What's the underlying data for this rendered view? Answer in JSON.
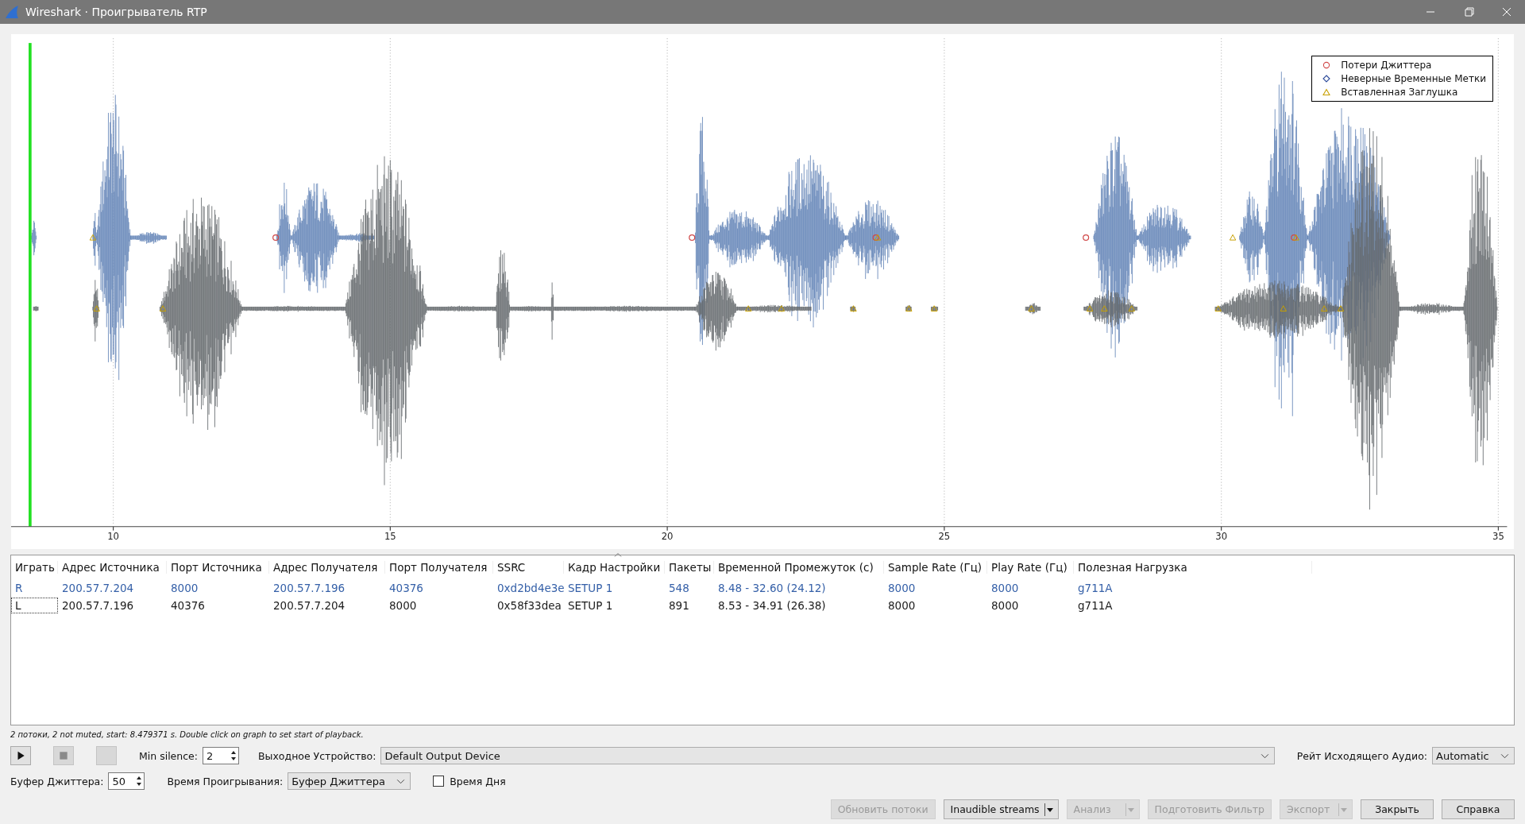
{
  "window": {
    "title": "Wireshark · Проигрыватель RTP"
  },
  "graph": {
    "x_ticks": [
      "10",
      "15",
      "20",
      "25",
      "30",
      "35"
    ],
    "legend": [
      {
        "label": "Потери Джиттера",
        "kind": "circle",
        "color": "#d04848"
      },
      {
        "label": "Неверные Временные Метки",
        "kind": "diamond",
        "color": "#2c4a9a"
      },
      {
        "label": "Вставленная Заглушка",
        "kind": "triangle",
        "color": "#c8a000"
      }
    ]
  },
  "streams_table": {
    "columns": [
      {
        "label": "Играть",
        "sorted": false
      },
      {
        "label": "Адрес Источника",
        "sorted": false
      },
      {
        "label": "Порт Источника",
        "sorted": false
      },
      {
        "label": "Адрес Получателя",
        "sorted": false
      },
      {
        "label": "Порт Получателя",
        "sorted": false
      },
      {
        "label": "SSRC",
        "sorted": false
      },
      {
        "label": "Кадр Настройки",
        "sorted": true
      },
      {
        "label": "Пакеты",
        "sorted": false
      },
      {
        "label": "Временной Промежуток (с)",
        "sorted": false
      },
      {
        "label": "Sample Rate (Гц)",
        "sorted": false
      },
      {
        "label": "Play Rate (Гц)",
        "sorted": false
      },
      {
        "label": "Полезная Нагрузка",
        "sorted": false
      }
    ],
    "rows": [
      {
        "color": "#3560a8",
        "focused": false,
        "cells": [
          "R",
          "200.57.7.204",
          "8000",
          "200.57.7.196",
          "40376",
          "0xd2bd4e3e",
          "SETUP 1",
          "548",
          "8.48 - 32.60 (24.12)",
          "8000",
          "8000",
          "g711A"
        ]
      },
      {
        "color": "#1a1a1a",
        "focused": true,
        "cells": [
          "L",
          "200.57.7.196",
          "40376",
          "200.57.7.204",
          "8000",
          "0x58f33dea",
          "SETUP 1",
          "891",
          "8.53 - 34.91 (26.38)",
          "8000",
          "8000",
          "g711A"
        ]
      }
    ]
  },
  "status_text": "2 потоки, 2 not muted, start: 8.479371 s. Double click on graph to set start of playback.",
  "playback_buttons": [
    {
      "kind": "play",
      "disabled": false
    },
    {
      "kind": "stop",
      "disabled": true
    },
    {
      "kind": "blank",
      "disabled": true
    }
  ],
  "min_silence": {
    "label": "Min silence:",
    "value": "2"
  },
  "output_device": {
    "label": "Выходное Устройство:",
    "value": "Default Output Device"
  },
  "output_rate": {
    "label": "Рейт Исходящего Аудио:",
    "value": "Automatic"
  },
  "jitter_buffer": {
    "label": "Буфер Джиттера:",
    "value": "50"
  },
  "playback_time": {
    "label": "Время Проигрывания:",
    "value": "Буфер Джиттера"
  },
  "time_of_day": {
    "label": "Время Дня",
    "checked": false
  },
  "buttons": [
    {
      "label": "Обновить потоки",
      "disabled": true,
      "dropdown": false
    },
    {
      "label": "Inaudible streams",
      "disabled": false,
      "dropdown": true
    },
    {
      "label": "Анализ",
      "disabled": true,
      "dropdown": true
    },
    {
      "label": "Подготовить Фильтр",
      "disabled": true,
      "dropdown": false
    },
    {
      "label": "Экспорт",
      "disabled": true,
      "dropdown": true
    },
    {
      "label": "Закрыть",
      "disabled": false,
      "dropdown": false
    },
    {
      "label": "Справка",
      "disabled": false,
      "dropdown": false
    }
  ]
}
